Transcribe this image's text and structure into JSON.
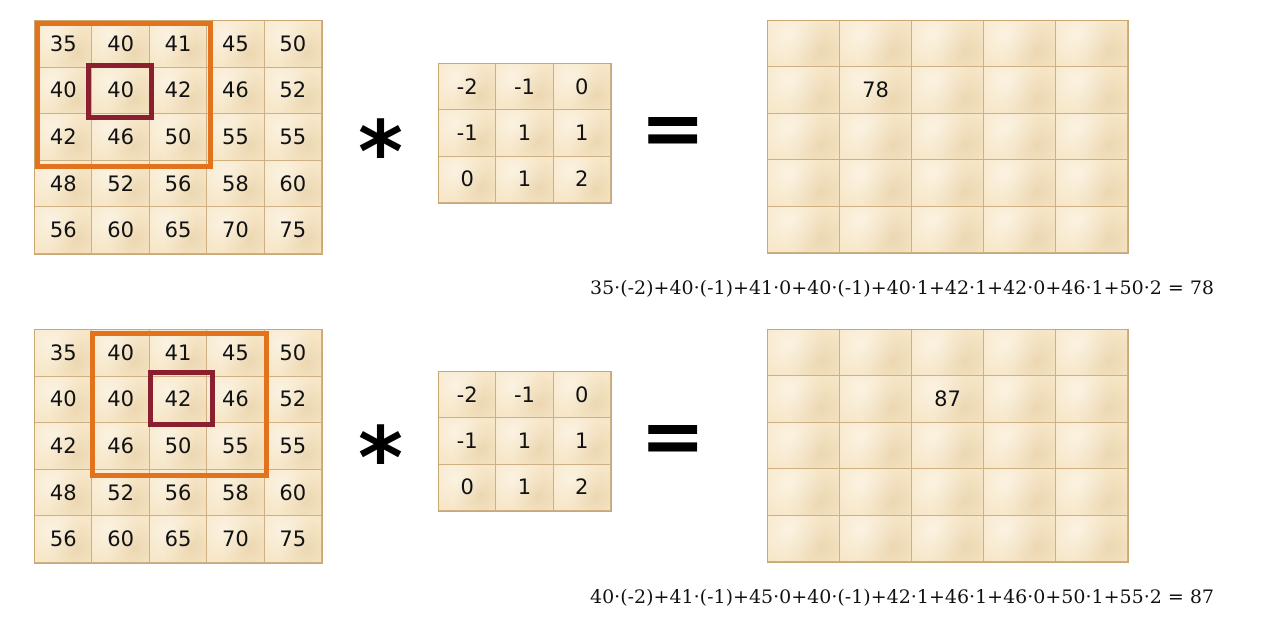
{
  "rows": [
    {
      "input": [
        [
          "35",
          "40",
          "41",
          "45",
          "50"
        ],
        [
          "40",
          "40",
          "42",
          "46",
          "52"
        ],
        [
          "42",
          "46",
          "50",
          "55",
          "55"
        ],
        [
          "48",
          "52",
          "56",
          "58",
          "60"
        ],
        [
          "56",
          "60",
          "65",
          "70",
          "75"
        ]
      ],
      "kernel": [
        [
          "-2",
          "-1",
          "0"
        ],
        [
          "-1",
          "1",
          "1"
        ],
        [
          "0",
          "1",
          "2"
        ]
      ],
      "operator": "*",
      "equals": "=",
      "output": [
        [
          "",
          "",
          "",
          "",
          ""
        ],
        [
          "",
          "78",
          "",
          "",
          ""
        ],
        [
          "",
          "",
          "",
          "",
          ""
        ],
        [
          "",
          "",
          "",
          "",
          ""
        ],
        [
          "",
          "",
          "",
          "",
          ""
        ]
      ],
      "formula": "35·(-2)+40·(-1)+41·0+40·(-1)+40·1+42·1+42·0+46·1+50·2 = 78"
    },
    {
      "input": [
        [
          "35",
          "40",
          "41",
          "45",
          "50"
        ],
        [
          "40",
          "40",
          "42",
          "46",
          "52"
        ],
        [
          "42",
          "46",
          "50",
          "55",
          "55"
        ],
        [
          "48",
          "52",
          "56",
          "58",
          "60"
        ],
        [
          "56",
          "60",
          "65",
          "70",
          "75"
        ]
      ],
      "kernel": [
        [
          "-2",
          "-1",
          "0"
        ],
        [
          "-1",
          "1",
          "1"
        ],
        [
          "0",
          "1",
          "2"
        ]
      ],
      "operator": "*",
      "equals": "=",
      "output": [
        [
          "",
          "",
          "",
          "",
          ""
        ],
        [
          "",
          "",
          "87",
          "",
          ""
        ],
        [
          "",
          "",
          "",
          "",
          ""
        ],
        [
          "",
          "",
          "",
          "",
          ""
        ],
        [
          "",
          "",
          "",
          "",
          ""
        ]
      ],
      "formula": "40·(-2)+41·(-1)+45·0+40·(-1)+42·1+46·1+46·0+50·1+55·2 = 87"
    }
  ],
  "colors": {
    "window_outline": "#e2731c",
    "center_outline": "#8a1f30",
    "cell_fill": "#f7e7c8",
    "cell_border": "#cdb083"
  }
}
